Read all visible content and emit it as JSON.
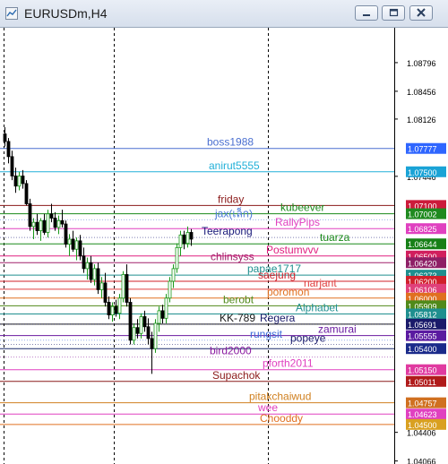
{
  "window": {
    "title": "EURUSDm,H4",
    "buttons": [
      "minimize-icon",
      "restore-icon",
      "close-icon"
    ]
  },
  "chart_data": {
    "type": "candlestick",
    "symbol": "EURUSDm",
    "timeframe": "H4",
    "ylim": [
      1.0403,
      1.0921
    ],
    "y_ticks": [
      "1.08796",
      "1.08456",
      "1.08126",
      "1.07446",
      "1.04406",
      "1.04066"
    ],
    "grid": false,
    "price_levels": [
      {
        "name": "boss1988",
        "price": 1.07777,
        "label": "1.07777",
        "color": "#4a6fd0",
        "badge": "#2f66ff"
      },
      {
        "name": "anirut5555",
        "price": 1.075,
        "label": "1.07500",
        "color": "#22b0d8",
        "badge": "#1aa3d6"
      },
      {
        "name": "friday",
        "price": 1.071,
        "label": "1.07100",
        "color": "#8b1a1a",
        "badge": "#cc1a3a"
      },
      {
        "name": "kubeever",
        "price": 1.07002,
        "label": "1.07002",
        "color": "#1a8a1a",
        "badge": "#1f8a1f"
      },
      {
        "name": "jax(เล็ก)",
        "price": 1.0693,
        "label": "",
        "color": "#4a78d8",
        "badge": ""
      },
      {
        "name": "RallyPips",
        "price": 1.06825,
        "label": "1.06825",
        "color": "#e040c0",
        "badge": "#e040c0"
      },
      {
        "name": "Teerapong",
        "price": 1.0672,
        "label": "",
        "color": "#1a1a7a",
        "badge": ""
      },
      {
        "name": "tuarza",
        "price": 1.06644,
        "label": "1.06644",
        "color": "#1a8a1a",
        "badge": "#178017"
      },
      {
        "name": "Postumvvv",
        "price": 1.065,
        "label": "1.06500",
        "color": "#e02080",
        "badge": "#d11f5e"
      },
      {
        "name": "chlinsyss",
        "price": 1.0642,
        "label": "1.06420",
        "color": "#a0206a",
        "badge": "#8e1f66"
      },
      {
        "name": "papae1717",
        "price": 1.06273,
        "label": "1.06273",
        "color": "#1f8f8f",
        "badge": "#1f8f8f"
      },
      {
        "name": "saejung",
        "price": 1.062,
        "label": "1.06200",
        "color": "#d0202a",
        "badge": "#d0202a"
      },
      {
        "name": "narjant",
        "price": 1.06106,
        "label": "1.06106",
        "color": "#e04040",
        "badge": "#e0407a"
      },
      {
        "name": "poromon",
        "price": 1.06,
        "label": "1.06000",
        "color": "#e07020",
        "badge": "#e07020"
      },
      {
        "name": "berobt",
        "price": 1.05909,
        "label": "1.05909",
        "color": "#508a1a",
        "badge": "#508a1a"
      },
      {
        "name": "Alphabet",
        "price": 1.05812,
        "label": "1.05812",
        "color": "#1f8f8f",
        "badge": "#1f8f8f"
      },
      {
        "name": "KK-789",
        "price": 1.05691,
        "label": "1.05691",
        "color": "#1a1a1a",
        "badge": "#1a1a6a"
      },
      {
        "name": "Regera",
        "price": 1.0569,
        "label": "",
        "color": "#1a1a6a",
        "badge": ""
      },
      {
        "name": "zamurai",
        "price": 1.05555,
        "label": "1.05555",
        "color": "#6a1aa0",
        "badge": "#5a1aa0"
      },
      {
        "name": "rungsit",
        "price": 1.055,
        "label": "",
        "color": "#3a6ad8",
        "badge": ""
      },
      {
        "name": "popeye",
        "price": 1.0545,
        "label": "",
        "color": "#1a1a6a",
        "badge": ""
      },
      {
        "name": "",
        "price": 1.054,
        "label": "1.05400",
        "color": "#1a2a6a",
        "badge": "#1a2a8a"
      },
      {
        "name": "bird2000",
        "price": 1.053,
        "label": "",
        "color": "#8a1aa0",
        "badge": ""
      },
      {
        "name": "pforth2011",
        "price": 1.0515,
        "label": "1.05150",
        "color": "#e040c0",
        "badge": "#e03aa0"
      },
      {
        "name": "Supachok",
        "price": 1.05011,
        "label": "1.05011",
        "color": "#8b1a1a",
        "badge": "#b01a1a"
      },
      {
        "name": "pitakchaiwud",
        "price": 1.04757,
        "label": "1.04757",
        "color": "#d08020",
        "badge": "#d07020"
      },
      {
        "name": "wee",
        "price": 1.04623,
        "label": "1.04623",
        "color": "#e040c0",
        "badge": "#e040c0"
      },
      {
        "name": "Chooddy",
        "price": 1.045,
        "label": "1.04500",
        "color": "#e07020",
        "badge": "#d9a020"
      }
    ],
    "candles": [
      {
        "o": 1.0795,
        "h": 1.0803,
        "l": 1.078,
        "c": 1.0786
      },
      {
        "o": 1.0786,
        "h": 1.079,
        "l": 1.076,
        "c": 1.0768
      },
      {
        "o": 1.0768,
        "h": 1.0775,
        "l": 1.074,
        "c": 1.0745
      },
      {
        "o": 1.0745,
        "h": 1.0755,
        "l": 1.0725,
        "c": 1.0733
      },
      {
        "o": 1.0733,
        "h": 1.075,
        "l": 1.0728,
        "c": 1.0745
      },
      {
        "o": 1.0745,
        "h": 1.0752,
        "l": 1.073,
        "c": 1.0736
      },
      {
        "o": 1.0736,
        "h": 1.074,
        "l": 1.071,
        "c": 1.0712
      },
      {
        "o": 1.0712,
        "h": 1.0718,
        "l": 1.068,
        "c": 1.0685
      },
      {
        "o": 1.0685,
        "h": 1.0695,
        "l": 1.067,
        "c": 1.069
      },
      {
        "o": 1.069,
        "h": 1.07,
        "l": 1.0675,
        "c": 1.068
      },
      {
        "o": 1.068,
        "h": 1.0695,
        "l": 1.0668,
        "c": 1.0692
      },
      {
        "o": 1.0692,
        "h": 1.07,
        "l": 1.0675,
        "c": 1.0678
      },
      {
        "o": 1.0678,
        "h": 1.0705,
        "l": 1.0672,
        "c": 1.07
      },
      {
        "o": 1.07,
        "h": 1.0712,
        "l": 1.069,
        "c": 1.0695
      },
      {
        "o": 1.0695,
        "h": 1.0702,
        "l": 1.068,
        "c": 1.0684
      },
      {
        "o": 1.0684,
        "h": 1.0698,
        "l": 1.0676,
        "c": 1.0692
      },
      {
        "o": 1.0692,
        "h": 1.0705,
        "l": 1.0684,
        "c": 1.0688
      },
      {
        "o": 1.0688,
        "h": 1.0692,
        "l": 1.066,
        "c": 1.0664
      },
      {
        "o": 1.0664,
        "h": 1.0676,
        "l": 1.065,
        "c": 1.067
      },
      {
        "o": 1.067,
        "h": 1.068,
        "l": 1.0655,
        "c": 1.0658
      },
      {
        "o": 1.0658,
        "h": 1.0672,
        "l": 1.0645,
        "c": 1.0668
      },
      {
        "o": 1.0668,
        "h": 1.0675,
        "l": 1.0645,
        "c": 1.065
      },
      {
        "o": 1.065,
        "h": 1.066,
        "l": 1.063,
        "c": 1.0635
      },
      {
        "o": 1.0635,
        "h": 1.0648,
        "l": 1.0622,
        "c": 1.0642
      },
      {
        "o": 1.0642,
        "h": 1.065,
        "l": 1.0618,
        "c": 1.0622
      },
      {
        "o": 1.0622,
        "h": 1.064,
        "l": 1.0615,
        "c": 1.0635
      },
      {
        "o": 1.0635,
        "h": 1.0642,
        "l": 1.0605,
        "c": 1.061
      },
      {
        "o": 1.061,
        "h": 1.0625,
        "l": 1.06,
        "c": 1.0618
      },
      {
        "o": 1.0618,
        "h": 1.063,
        "l": 1.059,
        "c": 1.0595
      },
      {
        "o": 1.0595,
        "h": 1.0602,
        "l": 1.0575,
        "c": 1.058
      },
      {
        "o": 1.058,
        "h": 1.0595,
        "l": 1.0572,
        "c": 1.059
      },
      {
        "o": 1.059,
        "h": 1.0598,
        "l": 1.0578,
        "c": 1.0582
      },
      {
        "o": 1.0582,
        "h": 1.0605,
        "l": 1.0575,
        "c": 1.06
      },
      {
        "o": 1.06,
        "h": 1.0632,
        "l": 1.0595,
        "c": 1.0628
      },
      {
        "o": 1.0628,
        "h": 1.064,
        "l": 1.059,
        "c": 1.0595
      },
      {
        "o": 1.0595,
        "h": 1.06,
        "l": 1.0545,
        "c": 1.055
      },
      {
        "o": 1.055,
        "h": 1.057,
        "l": 1.0545,
        "c": 1.0565
      },
      {
        "o": 1.0565,
        "h": 1.0575,
        "l": 1.0552,
        "c": 1.0558
      },
      {
        "o": 1.0558,
        "h": 1.0582,
        "l": 1.0552,
        "c": 1.0578
      },
      {
        "o": 1.0578,
        "h": 1.0585,
        "l": 1.056,
        "c": 1.0566
      },
      {
        "o": 1.0566,
        "h": 1.0576,
        "l": 1.0545,
        "c": 1.0552
      },
      {
        "o": 1.0552,
        "h": 1.056,
        "l": 1.051,
        "c": 1.054
      },
      {
        "o": 1.054,
        "h": 1.0575,
        "l": 1.0535,
        "c": 1.057
      },
      {
        "o": 1.057,
        "h": 1.059,
        "l": 1.056,
        "c": 1.0585
      },
      {
        "o": 1.0585,
        "h": 1.0592,
        "l": 1.057,
        "c": 1.0576
      },
      {
        "o": 1.0576,
        "h": 1.0605,
        "l": 1.057,
        "c": 1.06
      },
      {
        "o": 1.06,
        "h": 1.0625,
        "l": 1.0595,
        "c": 1.062
      },
      {
        "o": 1.062,
        "h": 1.064,
        "l": 1.0612,
        "c": 1.0635
      },
      {
        "o": 1.0635,
        "h": 1.0665,
        "l": 1.063,
        "c": 1.066
      },
      {
        "o": 1.066,
        "h": 1.068,
        "l": 1.065,
        "c": 1.0675
      },
      {
        "o": 1.0675,
        "h": 1.068,
        "l": 1.0658,
        "c": 1.0665
      },
      {
        "o": 1.0665,
        "h": 1.0685,
        "l": 1.066,
        "c": 1.0678
      },
      {
        "o": 1.0678,
        "h": 1.0682,
        "l": 1.0662,
        "c": 1.067
      }
    ]
  }
}
